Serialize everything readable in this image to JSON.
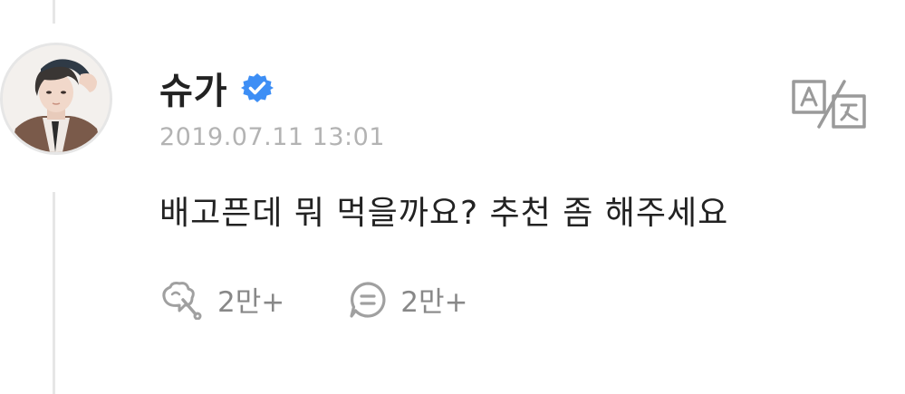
{
  "post": {
    "author": "슈가",
    "verified": true,
    "timestamp": "2019.07.11 13:01",
    "message": "배고픈데 뭐 먹을까요? 추천 좀 해주세요",
    "like_count": "2만+",
    "comment_count": "2만+"
  },
  "icons": {
    "verified": "verified-badge-icon",
    "translate": "translate-icon",
    "like": "cheers-bubble-icon",
    "comment": "comment-bubble-icon"
  },
  "colors": {
    "verified_blue": "#3d8ef5",
    "text_primary": "#222222",
    "text_muted": "#b3b3b3",
    "icon_gray": "#999999",
    "thread_line": "#e6e6e6"
  }
}
